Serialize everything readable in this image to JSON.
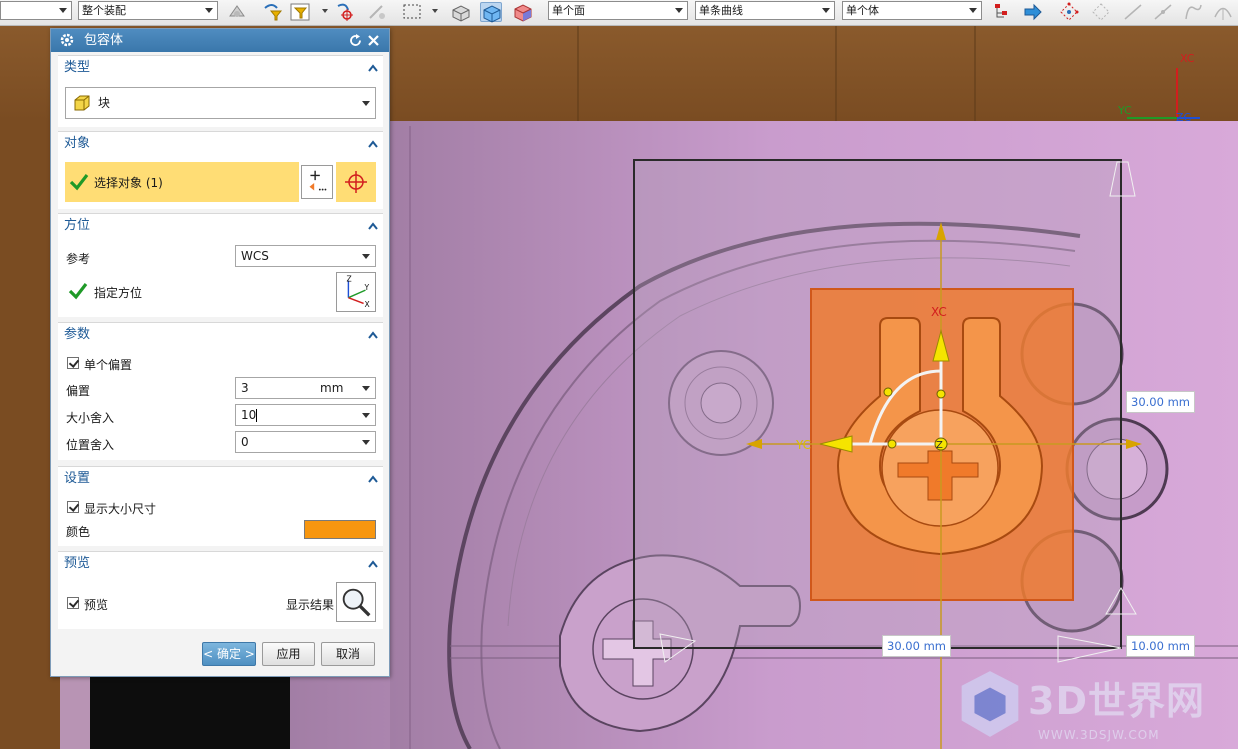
{
  "toolbar": {
    "select_filter": "",
    "select_assembly": "整个装配",
    "select_face": "单个面",
    "select_curve": "单条曲线",
    "select_body": "单个体"
  },
  "viewport": {
    "triad_labels": {
      "x": "XC",
      "y": "YC",
      "z": "ZC"
    },
    "handle_labels": {
      "x": "XC",
      "y": "YC",
      "z": "Z"
    },
    "dims": {
      "right_top": "30.00 mm",
      "bottom_left": "30.00 mm",
      "bottom_right": "10.00 mm"
    },
    "watermark": {
      "text": "3D世界网",
      "url": "WWW.3DSJW.COM"
    },
    "box_color": "#f07a2a"
  },
  "dialog": {
    "title": "包容体",
    "type_section": {
      "header": "类型",
      "type_value": "块"
    },
    "object_section": {
      "header": "对象",
      "select_label": "选择对象 (1)"
    },
    "orient_section": {
      "header": "方位",
      "ref_label": "参考",
      "ref_value": "WCS",
      "orient_label": "指定方位"
    },
    "param_section": {
      "header": "参数",
      "single_offset_label": "单个偏置",
      "offset_label": "偏置",
      "offset_value": "3",
      "offset_unit": "mm",
      "size_round_label": "大小舍入",
      "size_round_value": "10",
      "pos_round_label": "位置舍入",
      "pos_round_value": "0"
    },
    "settings_section": {
      "header": "设置",
      "show_size_label": "显示大小尺寸",
      "color_label": "颜色",
      "color_value": "#f7960f"
    },
    "preview_section": {
      "header": "预览",
      "preview_label": "预览",
      "show_result_label": "显示结果"
    },
    "buttons": {
      "ok": "< 确定 >",
      "apply": "应用",
      "cancel": "取消"
    }
  }
}
